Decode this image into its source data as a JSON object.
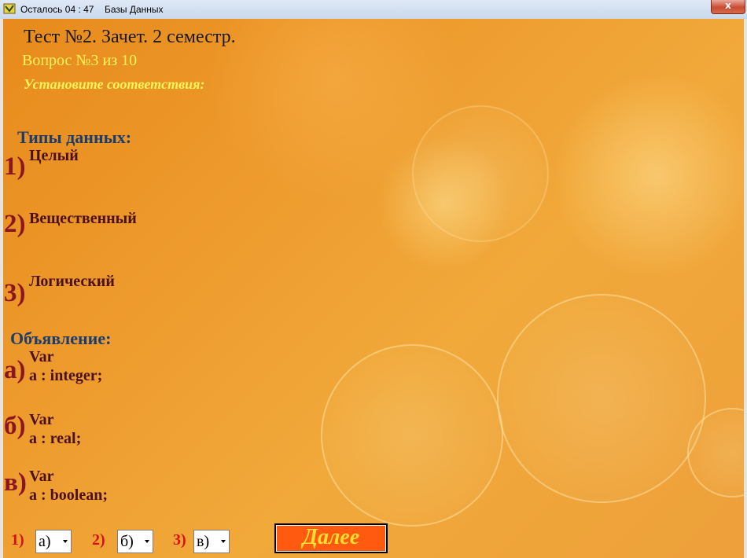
{
  "window": {
    "timer_label": "Осталось 04 : 47",
    "title": "Базы Данных",
    "close_glyph": "x"
  },
  "test": {
    "title": "Тест №2. Зачет. 2 семестр.",
    "question_counter": "Вопрос №3 из 10",
    "instruction": "Установите соответствия:"
  },
  "left_column": {
    "heading": "Типы данных:",
    "items": [
      {
        "marker": "1)",
        "text": "Целый"
      },
      {
        "marker": "2)",
        "text": "Вещественный"
      },
      {
        "marker": "3)",
        "text": "Логический"
      }
    ]
  },
  "right_column": {
    "heading": "Объявление:",
    "items": [
      {
        "marker": "а)",
        "line1": "Var",
        "line2": "a : integer;"
      },
      {
        "marker": "б)",
        "line1": "Var",
        "line2": "a : real;"
      },
      {
        "marker": "в)",
        "line1": "Var",
        "line2": "a : boolean;"
      }
    ]
  },
  "answers": [
    {
      "label": "1)",
      "selected": "а)"
    },
    {
      "label": "2)",
      "selected": "б)"
    },
    {
      "label": "3)",
      "selected": "в)"
    }
  ],
  "next_button": "Далее",
  "colors": {
    "background": "#ee9c2e",
    "heading": "#1c3c6c",
    "marker": "#8b1520",
    "highlight_text": "#fff65a",
    "next_button_bg": "#ff5a0f",
    "next_button_text": "#ffe033"
  }
}
